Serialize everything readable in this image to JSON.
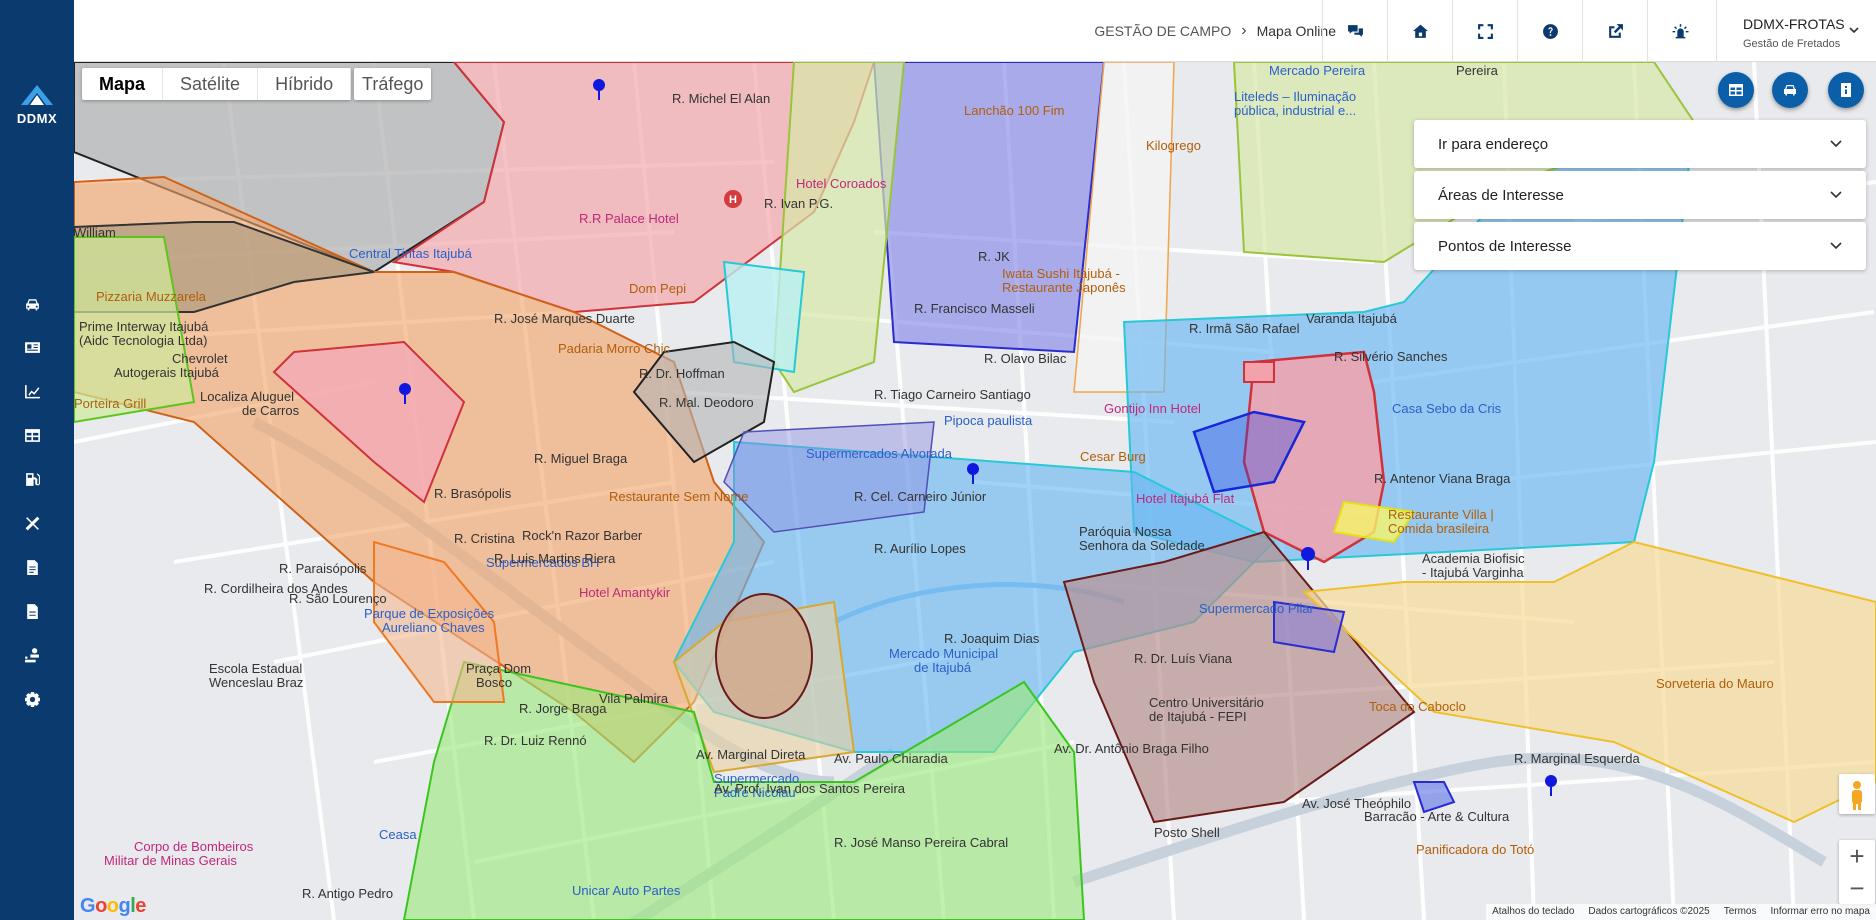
{
  "brand": {
    "logo_text": "DDMX",
    "accent": "#0b3b6e"
  },
  "sidebar": {
    "items": [
      {
        "icon": "car-icon"
      },
      {
        "icon": "id-card-icon"
      },
      {
        "icon": "chart-line-icon"
      },
      {
        "icon": "table-icon"
      },
      {
        "icon": "gas-pump-icon"
      },
      {
        "icon": "tools-icon"
      },
      {
        "icon": "file-icon"
      },
      {
        "icon": "file-alt-icon"
      },
      {
        "icon": "user-route-icon"
      },
      {
        "icon": "settings-icon"
      }
    ]
  },
  "header": {
    "breadcrumb": {
      "parent": "GESTÃO DE CAMPO",
      "current": "Mapa Online"
    },
    "toolbar_icons": [
      "chat-icon",
      "home-icon",
      "fullscreen-icon",
      "help-icon",
      "external-link-icon",
      "alarm-icon"
    ],
    "account": {
      "name": "DDMX-FROTAS",
      "subtitle": "Gestão de Fretados"
    }
  },
  "map": {
    "map_types": [
      "Mapa",
      "Satélite",
      "Híbrido"
    ],
    "active_type": "Mapa",
    "traffic_label": "Tráfego",
    "fabs": [
      "table-icon",
      "car-icon",
      "info-icon"
    ],
    "panels": [
      "Ir para endereço",
      "Áreas de Interesse",
      "Pontos de Interesse"
    ],
    "zoom_in": "+",
    "zoom_out": "−",
    "google_logo": "Google",
    "attribution": [
      "Atalhos do teclado",
      "Dados cartográficos ©2025",
      "Termos",
      "Informar erro no mapa"
    ],
    "labels": {
      "michel_el_alan": "R. Michel El Alan",
      "lanchao": "Lanchão 100 Fim",
      "mercado_pereira": "Mercado Pereira",
      "liteleds": "Liteleds – Iluminação",
      "liteleds2": "pública, industrial e...",
      "kilogrego": "Kilogrego",
      "hotel_coroados": "Hotel Coroados",
      "ivan_pg": "R. Ivan P.G.",
      "rr_palace": "R.R Palace Hotel",
      "central_tintas": "Central Tintas Itajubá",
      "pizzaria": "Pizzaria Muzzarela",
      "prime_interway": "Prime Interway Itajubá",
      "prime_interway2": "(Aidc Tecnologia Ltda)",
      "chevrolet": "Chevrolet",
      "chevrolet2": "Autogerais Itajubá",
      "localiza": "Localiza Aluguel",
      "localiza2": "de Carros",
      "porteira": "Porteira Grill",
      "dom_pepi": "Dom Pepi",
      "padaria": "Padaria Morro Chic",
      "r_jk": "R. JK",
      "iwata": "Iwata Sushi Itajubá -",
      "iwata2": "Restaurante Japonês",
      "olavo_bilac": "R. Olavo Bilac",
      "tiago": "R. Tiago Carneiro Santiago",
      "hoffman": "R. Dr. Hoffman",
      "deodoro": "R. Mal. Deodoro",
      "pipoca": "Pipoca paulista",
      "gontijo": "Gontijo Inn Hotel",
      "cesar_burg": "Cesar Burg",
      "alvorada": "Supermercados Alvorada",
      "carneiro_junior": "R. Cel. Carneiro Júnior",
      "sem_nome": "Restaurante Sem Nome",
      "rock_razor": "Rock'n Razor Barber",
      "supermercados_bh": "Supermercados BH",
      "hotel_amantykir": "Hotel Amantykir",
      "aurilio": "R. Aurílio Lopes",
      "hotel_itajuba_flat": "Hotel Itajubá Flat",
      "paroquia": "Paróquia Nossa",
      "paroquia2": "Senhora da Soledade",
      "joaquim_dias": "R. Joaquim Dias",
      "mercado_municipal": "Mercado Municipal",
      "mercado_municipal2": "de Itajubá",
      "supermercado_pilar": "Supermercado Pilar",
      "centro_univ": "Centro Universitário",
      "centro_univ2": "de Itajubá - FEPI",
      "toca": "Toca do Caboclo",
      "varanda": "Varanda Itajubá",
      "silverio": "R. Silvério Sanches",
      "casa_sebo": "Casa Sebo da Cris",
      "antenor": "R. Antenor Viana Braga",
      "villa": "Restaurante Villa |",
      "villa2": "Comida brasileira",
      "academia": "Academia Biofisic",
      "academia2": "- Itajubá Varginha",
      "sorveteria": "Sorveteria do Mauro",
      "marginal_esq": "R. Marginal Esquerda",
      "theophilo": "Av. José Theóphilo",
      "barracao": "Barracão - Arte & Cultura",
      "panificadora": "Panificadora do Totó",
      "posto_shell": "Posto Shell",
      "unicar": "Unicar Auto Partes",
      "sup_padre": "Supermercado",
      "sup_padre2": "Padre Nicolau",
      "bombeiros": "Corpo de Bombeiros",
      "bombeiros2": "Militar de Minas Gerais",
      "ceasa": "Ceasa",
      "escola": "Escola Estadual",
      "escola2": "Wenceslau Braz",
      "parque": "Parque de Exposições",
      "parque2": "Aureliano Chaves",
      "praca": "Praça Dom",
      "praca2": "Bosco",
      "jorge_braga": "R. Jorge Braga",
      "luiz_renno": "R. Dr. Luiz Rennó",
      "paulo_chiaradia": "Av. Paulo Chiaradia",
      "jose_manso": "R. José Manso Pereira Cabral",
      "marginal_direta": "Av. Marginal Direta",
      "ivan_santos": "Av. Prof. Ivan dos Santos Pereira",
      "vila_palmira": "Vila Palmira",
      "brasopolis": "R. Brasópolis",
      "cristina": "R. Cristina",
      "luis_martins": "R. Luis Martins Riera",
      "miguel_braga": "R. Miguel Braga",
      "jose_marques": "R. José Marques Duarte",
      "antonio_braga": "Av. Dr. Antônio Braga Filho",
      "luis_viana": "R. Dr. Luís Viana",
      "cordilheira": "R. Cordilheira dos Andes",
      "paraisopolis": "R. Paraisópolis",
      "sao_lourenco": "R. São Lourenço",
      "antigo_pedro": "R. Antigo Pedro",
      "imma_sao_rafael": "R. Irmã São Rafael",
      "francisco_masseli": "R. Francisco Masseli",
      "william": "William",
      "pereira": "Pereira"
    }
  }
}
